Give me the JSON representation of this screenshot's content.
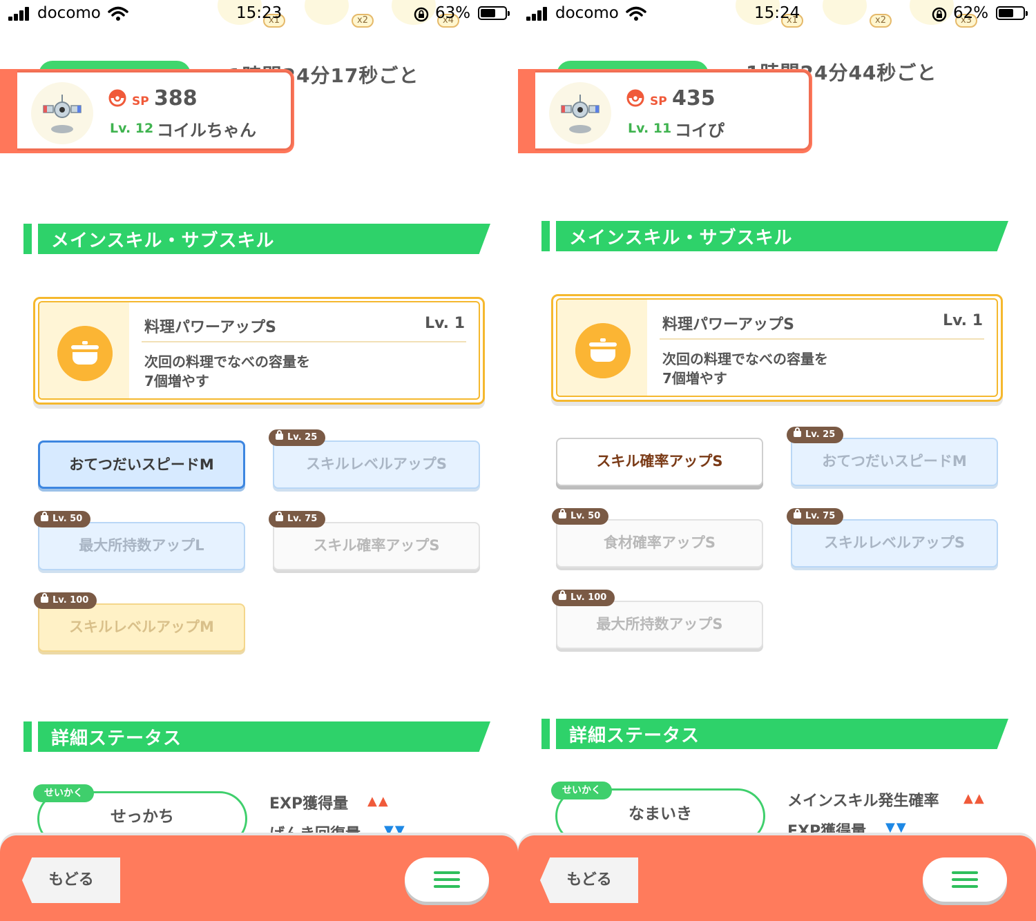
{
  "panels": [
    {
      "status": {
        "carrier": "docomo",
        "time": "15:23",
        "battery": "63%",
        "battery_fill": 0.63
      },
      "items": [
        "x1",
        "x2",
        "x4"
      ],
      "help_interval": "1時間24分17秒ごと",
      "pokemon": {
        "sp_label": "SP",
        "sp": "388",
        "level": "Lv. 12",
        "name": "コイルちゃん"
      },
      "section_skills": "メインスキル・サブスキル",
      "main_skill": {
        "name": "料理パワーアップS",
        "level": "Lv. 1",
        "desc1": "次回の料理でなべの容量を",
        "desc2": "7個増やす"
      },
      "sub_skills": [
        {
          "name": "おてつだいスピードM",
          "lock": ""
        },
        {
          "name": "スキルレベルアップS",
          "lock": "Lv. 25"
        },
        {
          "name": "最大所持数アップL",
          "lock": "Lv. 50"
        },
        {
          "name": "スキル確率アップS",
          "lock": "Lv. 75"
        },
        {
          "name": "スキルレベルアップM",
          "lock": "Lv. 100"
        }
      ],
      "section_status": "詳細ステータス",
      "nature": {
        "tag": "せいかく",
        "name": "せっかち",
        "up": "EXP獲得量",
        "up_arrows": "▲▲",
        "down": "げんき回復量",
        "down_arrows": "▼▼"
      },
      "back_label": "もどる"
    },
    {
      "status": {
        "carrier": "docomo",
        "time": "15:24",
        "battery": "62%",
        "battery_fill": 0.62
      },
      "items": [
        "x1",
        "x2",
        "x3"
      ],
      "help_interval": "1時間24分44秒ごと",
      "pokemon": {
        "sp_label": "SP",
        "sp": "435",
        "level": "Lv. 11",
        "name": "コイぴ"
      },
      "section_skills": "メインスキル・サブスキル",
      "main_skill": {
        "name": "料理パワーアップS",
        "level": "Lv. 1",
        "desc1": "次回の料理でなべの容量を",
        "desc2": "7個増やす"
      },
      "sub_skills": [
        {
          "name": "スキル確率アップS",
          "lock": ""
        },
        {
          "name": "おてつだいスピードM",
          "lock": "Lv. 25"
        },
        {
          "name": "食材確率アップS",
          "lock": "Lv. 50"
        },
        {
          "name": "スキルレベルアップS",
          "lock": "Lv. 75"
        },
        {
          "name": "最大所持数アップS",
          "lock": "Lv. 100"
        }
      ],
      "section_status": "詳細ステータス",
      "nature": {
        "tag": "せいかく",
        "name": "なまいき",
        "up": "メインスキル発生確率",
        "up_arrows": "▲▲",
        "down": "EXP獲得量",
        "down_arrows": "▼▼"
      },
      "back_label": "もどる"
    }
  ],
  "icons": [
    "signal-icon",
    "wifi-icon",
    "rotation-lock-icon",
    "battery-icon",
    "pokeball-icon",
    "pot-icon",
    "lock-icon",
    "hamburger-menu-icon"
  ],
  "colors": {
    "accent_green": "#2ed26a",
    "header_coral": "#ff7b5c",
    "gold": "#f5b82e",
    "blue": "#3d86e0"
  }
}
